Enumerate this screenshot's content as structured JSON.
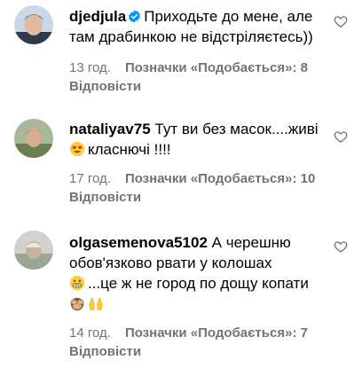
{
  "comments": [
    {
      "username": "djedjula",
      "verified": true,
      "text": "Приходьте до мене, але там драбинкою не відстріляєтесь))",
      "time": "13 год.",
      "likes": "Позначки «Подобається»: 8",
      "reply": "Відповісти"
    },
    {
      "username": "nataliyav75",
      "verified": false,
      "text_line1": "Тут ви без масок....живі",
      "text_line2": "класнючі !!!!",
      "emoji": "heart-eyes",
      "time": "17 год.",
      "likes": "Позначки «Подобається»: 10",
      "reply": "Відповісти"
    },
    {
      "username": "olgasemenova5102",
      "verified": false,
      "text_line1": "А черешню обов'язково рвати у колошах",
      "text_line2": "...це ж не город по дощу копати",
      "emoji_line2": "grimacing",
      "emoji_line3": [
        "see-no-evil-monkey",
        "raising-hands"
      ],
      "time": "14 год.",
      "likes": "Позначки «Подобається»: 7",
      "reply": "Відповісти"
    }
  ],
  "icons": {
    "like": "heart-outline-icon"
  },
  "colors": {
    "verified": "#0095f6",
    "meta": "#737373"
  }
}
